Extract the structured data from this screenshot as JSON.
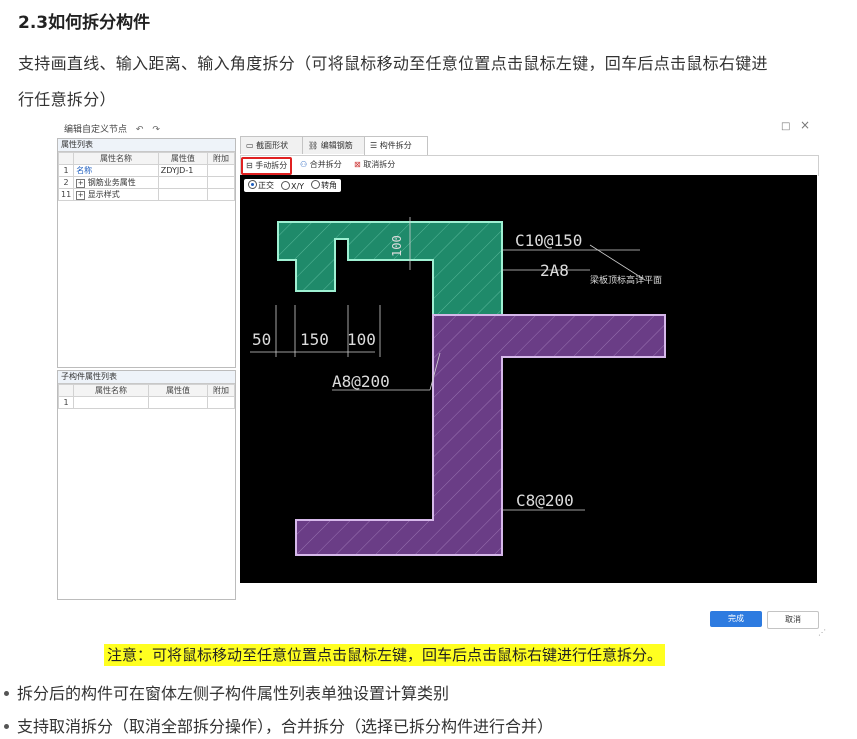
{
  "article": {
    "heading": "2.3如何拆分构件",
    "para_line1": "支持画直线、输入距离、输入角度拆分（可将鼠标移动至任意位置点击鼠标左键，回车后点击鼠标右键进",
    "para_line2": "行任意拆分）",
    "note": "注意：可将鼠标移动至任意位置点击鼠标左键，回车后点击鼠标右键进行任意拆分。",
    "bullets": [
      "拆分后的构件可在窗体左侧子构件属性列表单独设置计算类别",
      "支持取消拆分（取消全部拆分操作），合并拆分（选择已拆分构件进行合并）"
    ]
  },
  "dialog": {
    "title": "编辑自定义节点",
    "undo_icon": "↶",
    "redo_icon": "↷",
    "maximize_icon": "□",
    "close_icon": "×",
    "left_panel": {
      "title": "属性列表",
      "columns": [
        "属性名称",
        "属性值",
        "附加"
      ],
      "rows": [
        {
          "idx": "1",
          "expander": "",
          "name": "名称",
          "value": "ZDYJD-1"
        },
        {
          "idx": "2",
          "expander": "+",
          "name": "钢筋业务属性",
          "value": ""
        },
        {
          "idx": "11",
          "expander": "+",
          "name": "显示样式",
          "value": ""
        }
      ]
    },
    "sub_panel": {
      "title": "子构件属性列表",
      "columns": [
        "属性名称",
        "属性值",
        "附加"
      ],
      "rows": [
        {
          "idx": "1",
          "name": "",
          "value": ""
        }
      ]
    },
    "tabs": [
      {
        "label": "截面形状",
        "icon": "section-shape-icon",
        "active": false
      },
      {
        "label": "编辑钢筋",
        "icon": "edit-rebar-icon",
        "active": false
      },
      {
        "label": "构件拆分",
        "icon": "component-split-icon",
        "active": true
      }
    ],
    "toolbar": {
      "manual_split": "手动拆分",
      "merge_split": "合并拆分",
      "cancel_split": "取消拆分"
    },
    "radios": {
      "ortho": "正交",
      "xy": "X/Y",
      "angle": "转角",
      "selected": "ortho"
    },
    "drawing_labels": {
      "c10": "C10@150",
      "a2": "2A8",
      "side_note": "梁板顶标高详平面",
      "dim100_vert": "100",
      "dim50": "50",
      "dim150": "150",
      "dim100": "100",
      "a8": "A8@200",
      "c8": "C8@200"
    },
    "buttons": {
      "ok": "完成",
      "cancel": "取消"
    },
    "colors": {
      "highlight_red": "#e02020",
      "upper_shape": "#1f8a6a",
      "lower_shape": "#6a3d86",
      "primary_button": "#2d7be0"
    }
  }
}
